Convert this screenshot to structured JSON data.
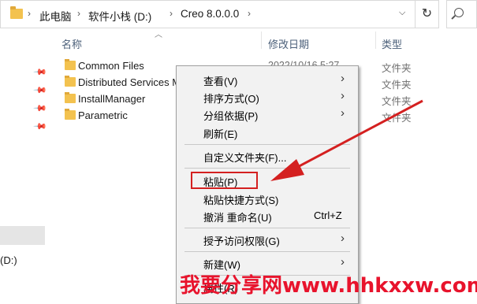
{
  "breadcrumb": {
    "items": [
      "此电脑",
      "软件小栈 (D:)",
      "Creo 8.0.0.0"
    ],
    "separator": "›"
  },
  "columns": {
    "name": "名称",
    "date": "修改日期",
    "type": "类型"
  },
  "files": [
    {
      "name": "Common Files",
      "date": "2022/10/16 5:27",
      "type": "文件夹"
    },
    {
      "name": "Distributed Services M",
      "date": "",
      "type": "文件夹"
    },
    {
      "name": "InstallManager",
      "date": "",
      "type": "文件夹"
    },
    {
      "name": "Parametric",
      "date": "",
      "type": "文件夹"
    }
  ],
  "left_pane": {
    "drive_label": "(D:)"
  },
  "context_menu": {
    "items": [
      {
        "label": "查看(V)",
        "submenu": true,
        "shortcut": ""
      },
      {
        "label": "排序方式(O)",
        "submenu": true,
        "shortcut": ""
      },
      {
        "label": "分组依据(P)",
        "submenu": true,
        "shortcut": ""
      },
      {
        "label": "刷新(E)",
        "submenu": false,
        "shortcut": ""
      },
      {
        "label": "自定义文件夹(F)...",
        "submenu": false,
        "shortcut": ""
      },
      {
        "label": "粘贴(P)",
        "submenu": false,
        "shortcut": ""
      },
      {
        "label": "粘贴快捷方式(S)",
        "submenu": false,
        "shortcut": ""
      },
      {
        "label": "撤消 重命名(U)",
        "submenu": false,
        "shortcut": "Ctrl+Z"
      },
      {
        "label": "授予访问权限(G)",
        "submenu": true,
        "shortcut": ""
      },
      {
        "label": "新建(W)",
        "submenu": true,
        "shortcut": ""
      },
      {
        "label": "属性(R)",
        "submenu": false,
        "shortcut": ""
      }
    ]
  },
  "watermark": {
    "text": "我要分享网www.hhkxxw.com"
  },
  "colors": {
    "highlight": "#d42020",
    "arrow": "#d42020",
    "folder": "#f3c24f"
  }
}
